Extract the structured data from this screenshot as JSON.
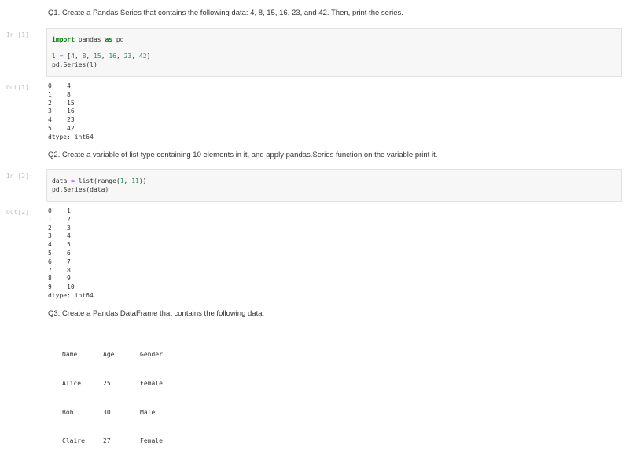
{
  "q1": {
    "text": "Q1. Create a Pandas Series that contains the following data: 4, 8, 15, 16, 23, and 42. Then, print the series.",
    "in_prompt": "In [1]:",
    "code": {
      "import_kw": "import",
      "import_rest": " pandas ",
      "as_kw": "as",
      "alias": " pd",
      "line2_pre": "l ",
      "line2_op": "=",
      "line2_post": " [",
      "nums": [
        "4",
        "8",
        "15",
        "16",
        "23",
        "42"
      ],
      "line3": "pd.Series(l)"
    },
    "out_prompt": "Out[1]:",
    "output": {
      "rows": [
        {
          "idx": "0",
          "val": "4"
        },
        {
          "idx": "1",
          "val": "8"
        },
        {
          "idx": "2",
          "val": "15"
        },
        {
          "idx": "3",
          "val": "16"
        },
        {
          "idx": "4",
          "val": "23"
        },
        {
          "idx": "5",
          "val": "42"
        }
      ],
      "dtype": "dtype: int64"
    }
  },
  "q2": {
    "text": "Q2. Create a variable of list type containing 10 elements in it, and apply pandas.Series function on the variable print it.",
    "in_prompt": "In [2]:",
    "code": {
      "line1_pre": "data ",
      "line1_op": "=",
      "line1_mid": " list(range(",
      "n1": "1",
      "sep": ", ",
      "n2": "11",
      "line1_end": "))",
      "line2": "pd.Series(data)"
    },
    "out_prompt": "Out[2]:",
    "output": {
      "rows": [
        {
          "idx": "0",
          "val": "1"
        },
        {
          "idx": "1",
          "val": "2"
        },
        {
          "idx": "2",
          "val": "3"
        },
        {
          "idx": "3",
          "val": "4"
        },
        {
          "idx": "4",
          "val": "5"
        },
        {
          "idx": "5",
          "val": "6"
        },
        {
          "idx": "6",
          "val": "7"
        },
        {
          "idx": "7",
          "val": "8"
        },
        {
          "idx": "8",
          "val": "9"
        },
        {
          "idx": "9",
          "val": "10"
        }
      ],
      "dtype": "dtype: int64"
    }
  },
  "q3": {
    "text": "Q3. Create a Pandas DataFrame that contains the following data:",
    "table": {
      "headers": [
        "Name",
        "Age",
        "Gender"
      ],
      "rows": [
        [
          "Alice",
          "25",
          "Female"
        ],
        [
          "Bob",
          "30",
          "Male"
        ],
        [
          "Claire",
          "27",
          "Female"
        ]
      ]
    }
  },
  "colors": {
    "keyword": "#008000",
    "number": "#2e8b57",
    "operator": "#aa22ff",
    "cell_bg": "#f7f7f7",
    "prompt": "#c0c0c0"
  }
}
